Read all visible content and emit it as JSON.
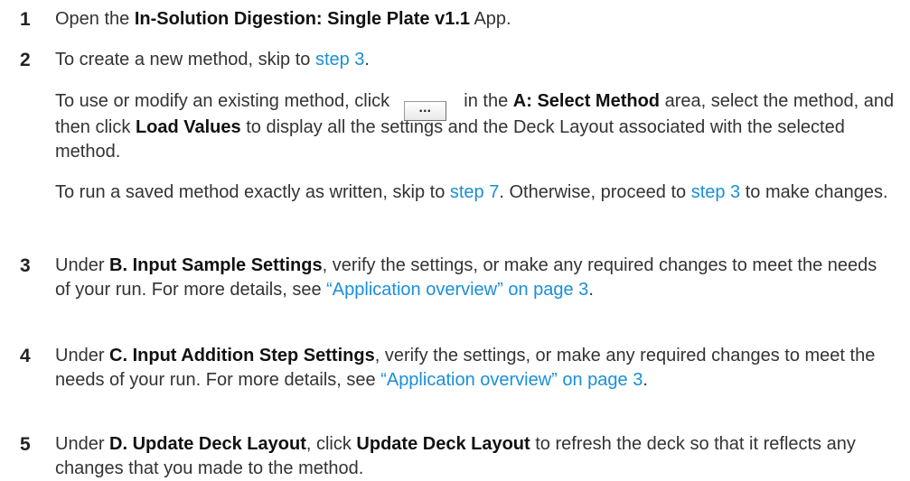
{
  "steps": [
    {
      "number": "1",
      "pre": "Open the ",
      "bold": "In-Solution Digestion: Single Plate v1.1",
      "post": " App."
    },
    {
      "number": "2",
      "pre": "To create a new method, skip to ",
      "link": "step 3",
      "post": ".",
      "para2": {
        "pre": "To use or modify an existing method, click ",
        "button_label": "...",
        "mid1": " in the ",
        "bold1": "A: Select Method",
        "mid2": " area, select the method, and then click ",
        "bold2": "Load Values",
        "post": " to display all the settings and the Deck Layout associated with the selected method."
      },
      "para3": {
        "pre": "To run a saved method exactly as written, skip to ",
        "link1": "step 7",
        "mid": ". Otherwise, proceed to ",
        "link2": "step 3",
        "post": " to make changes."
      }
    },
    {
      "number": "3",
      "pre": "Under ",
      "bold": "B. Input Sample Settings",
      "mid": ", verify the settings, or make any required changes to meet the needs of your run. For more details, see ",
      "link": "“Application overview” on page 3",
      "post": "."
    },
    {
      "number": "4",
      "pre": "Under ",
      "bold": "C. Input Addition Step Settings",
      "mid": ", verify the settings, or make any required changes to meet the needs of your run. For more details, see ",
      "link": "“Application overview” on page 3",
      "post": "."
    },
    {
      "number": "5",
      "pre": "Under ",
      "bold1": "D. Update Deck Layout",
      "mid": ", click ",
      "bold2": "Update Deck Layout",
      "post": " to refresh the deck so that it reflects any changes that you made to the method."
    }
  ],
  "colors": {
    "text": "#333333",
    "link": "#1a8fd8"
  }
}
